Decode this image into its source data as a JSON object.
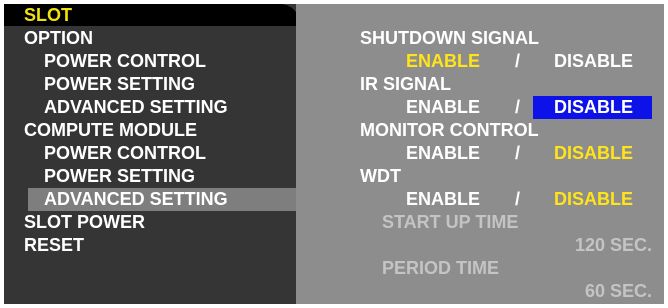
{
  "left_menu": {
    "header": "SLOT",
    "items": [
      {
        "label": "OPTION"
      },
      {
        "label": "POWER CONTROL"
      },
      {
        "label": "POWER SETTING"
      },
      {
        "label": "ADVANCED SETTING"
      },
      {
        "label": "COMPUTE MODULE"
      },
      {
        "label": "POWER CONTROL"
      },
      {
        "label": "POWER SETTING"
      },
      {
        "label": "ADVANCED SETTING"
      },
      {
        "label": "SLOT POWER"
      },
      {
        "label": "RESET"
      }
    ]
  },
  "right_panel": {
    "shutdown_signal": {
      "title": "SHUTDOWN SIGNAL",
      "enable": "ENABLE",
      "sep": "/",
      "disable": "DISABLE"
    },
    "ir_signal": {
      "title": "IR SIGNAL",
      "enable": "ENABLE",
      "sep": "/",
      "disable": "DISABLE"
    },
    "monitor_control": {
      "title": "MONITOR CONTROL",
      "enable": "ENABLE",
      "sep": "/",
      "disable": "DISABLE"
    },
    "wdt": {
      "title": "WDT",
      "enable": "ENABLE",
      "sep": "/",
      "disable": "DISABLE"
    },
    "start_up_time": {
      "label": "START UP TIME",
      "value": "120 SEC."
    },
    "period_time": {
      "label": "PERIOD TIME",
      "value": "60 SEC."
    }
  },
  "colors": {
    "left_bg": "#353535",
    "right_bg": "#8d8d8d",
    "selected_bg": "#7e7e7e",
    "header_text": "#f1e20c",
    "active_option": "#ffe41a",
    "focus_highlight": "#0c12e8"
  }
}
